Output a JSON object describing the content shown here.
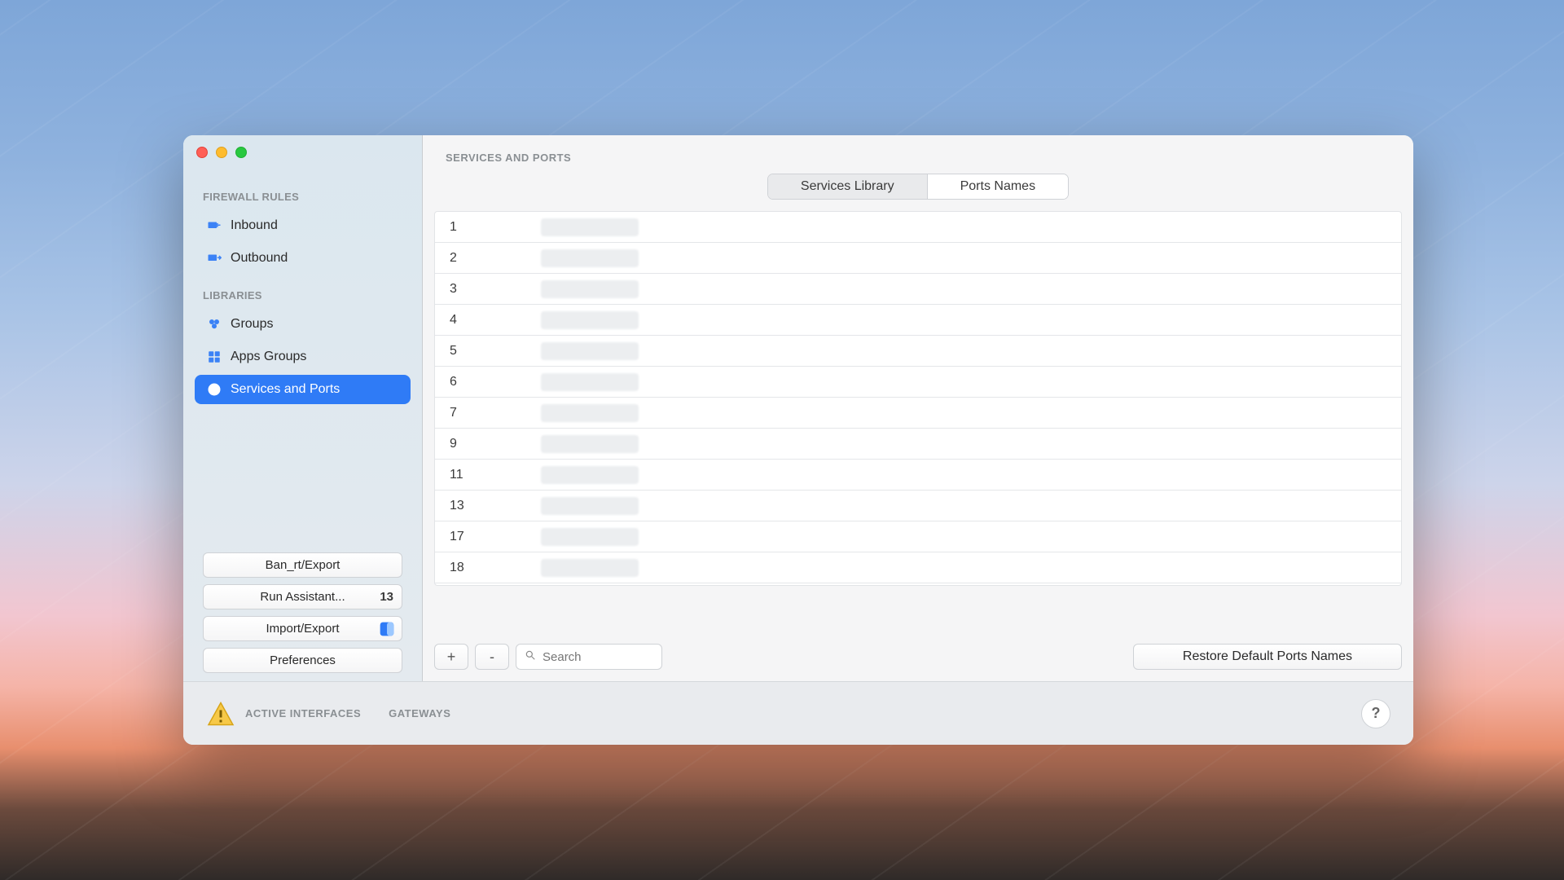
{
  "sidebar": {
    "section_firewall": "FIREWALL RULES",
    "section_libs": "LIBRARIES",
    "items": {
      "inbound": "Inbound",
      "outbound": "Outbound",
      "groups": "Groups",
      "apps_groups": "Apps Groups",
      "services_ports": "Services and Ports"
    },
    "buttons": {
      "ban_export": "Ban_rt/Export",
      "run_assistant": "Run Assistant...",
      "run_assistant_badge": "13",
      "import_export": "Import/Export",
      "preferences": "Preferences"
    }
  },
  "main": {
    "title": "SERVICES AND PORTS",
    "tabs": {
      "services_library": "Services Library",
      "ports_names": "Ports Names"
    },
    "ports": [
      "1",
      "2",
      "3",
      "4",
      "5",
      "6",
      "7",
      "9",
      "11",
      "13",
      "17",
      "18"
    ],
    "search_placeholder": "Search",
    "add_label": "+",
    "remove_label": "-",
    "restore_btn": "Restore Default Ports Names"
  },
  "status": {
    "active_interfaces": "ACTIVE INTERFACES",
    "gateways": "GATEWAYS",
    "help": "?"
  }
}
